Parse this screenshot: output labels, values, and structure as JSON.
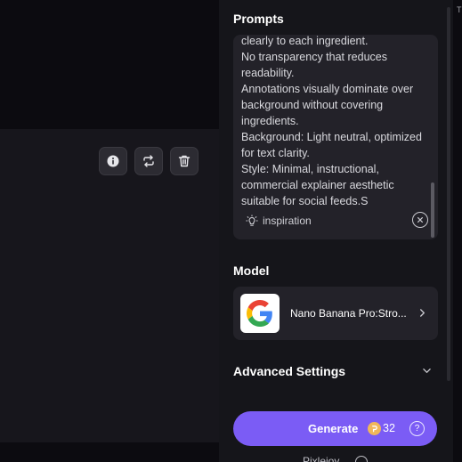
{
  "canvas": {
    "toolbar": {
      "info": "info-icon",
      "swap": "swap-icon",
      "delete": "trash-icon"
    }
  },
  "panel": {
    "prompts_title": "Prompts",
    "prompt_text": "clearly to each ingredient.\nNo transparency that reduces readability.\nAnnotations visually dominate over background without covering ingredients.\nBackground: Light neutral, optimized for text clarity.\nStyle: Minimal, instructional, commercial explainer aesthetic suitable for social feeds.S",
    "inspiration_label": "inspiration",
    "model_title": "Model",
    "model_name": "Nano Banana Pro:Stro...",
    "advanced_title": "Advanced Settings",
    "generate_label": "Generate",
    "credits": "32",
    "bottom_link": "Pixlejoy"
  },
  "edge_letter": "T",
  "colors": {
    "accent": "#7b5cf5",
    "panel": "#15151a",
    "card": "#232229",
    "coin": "#f0b75a"
  }
}
